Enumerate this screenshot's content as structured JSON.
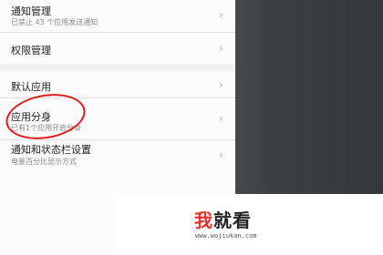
{
  "settings": {
    "items": [
      {
        "title": "通知管理",
        "subtitle": "已禁止 43 个应用发送通知"
      },
      {
        "title": "权限管理",
        "subtitle": ""
      },
      {
        "title": "默认应用",
        "subtitle": ""
      },
      {
        "title": "应用分身",
        "subtitle": "已有1个应用开启分身"
      },
      {
        "title": "通知和状态栏设置",
        "subtitle": "电量百分比显示方式"
      }
    ],
    "chevron": "›"
  },
  "watermark": {
    "brand_a": "我",
    "brand_b": "就看",
    "url": "www.wojiukan.com",
    "accent_color": "#e8312a"
  },
  "annotation": {
    "color": "#e01e1e"
  }
}
